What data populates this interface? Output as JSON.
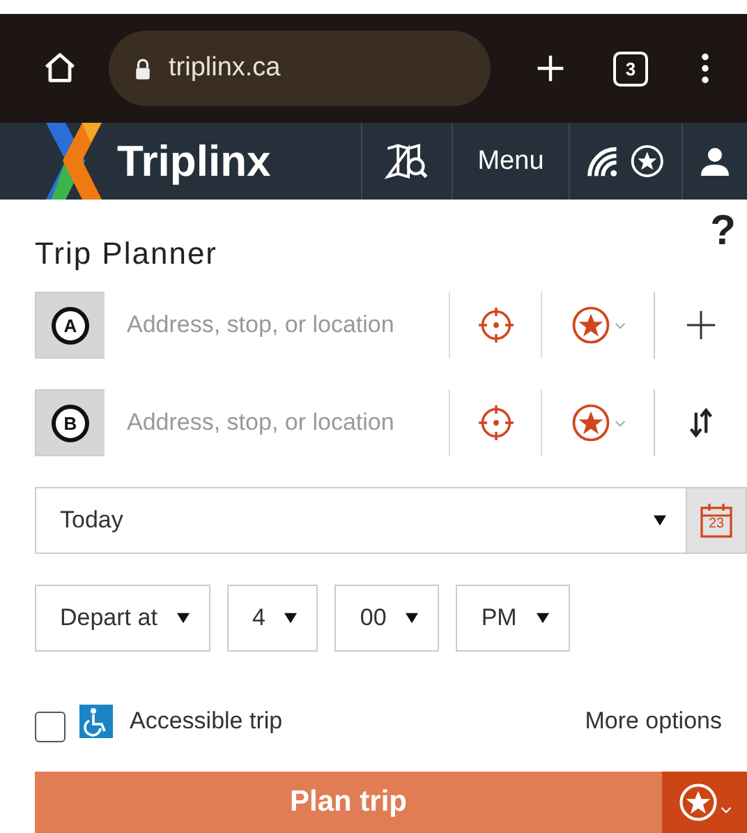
{
  "browser": {
    "url": "triplinx.ca",
    "tab_count": "3"
  },
  "header": {
    "logo": "Triplinx",
    "menu": "Menu"
  },
  "planner": {
    "title": "Trip Planner",
    "help": "?",
    "stops": [
      {
        "badge": "A",
        "placeholder": "Address, stop, or location",
        "kind": "add"
      },
      {
        "badge": "B",
        "placeholder": "Address, stop, or location",
        "kind": "swap"
      }
    ],
    "date": {
      "value": "Today",
      "calendar_day": "23"
    },
    "time": [
      {
        "value": "Depart at"
      },
      {
        "value": "4"
      },
      {
        "value": "00"
      },
      {
        "value": "PM"
      }
    ],
    "accessible": {
      "label": "Accessible trip",
      "checked": false
    },
    "more_options": "More options",
    "plan_button": "Plan trip"
  }
}
